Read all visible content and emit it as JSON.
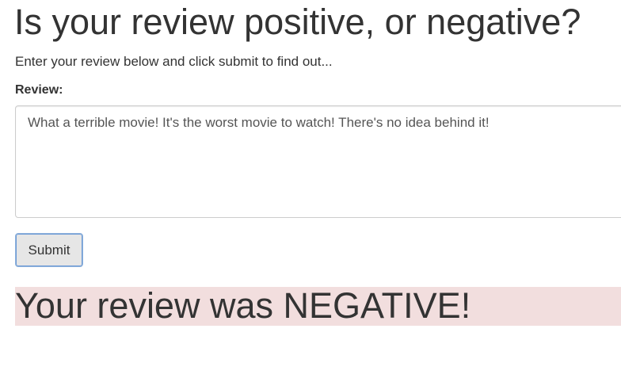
{
  "header": {
    "title": "Is your review positive, or negative?",
    "subtitle": "Enter your review below and click submit to find out..."
  },
  "form": {
    "review_label": "Review:",
    "review_value": "What a terrible movie! It's the worst movie to watch! There's no idea behind it!",
    "submit_label": "Submit"
  },
  "result": {
    "text": "Your review was NEGATIVE!",
    "sentiment": "NEGATIVE",
    "background_color": "#f2dede"
  }
}
